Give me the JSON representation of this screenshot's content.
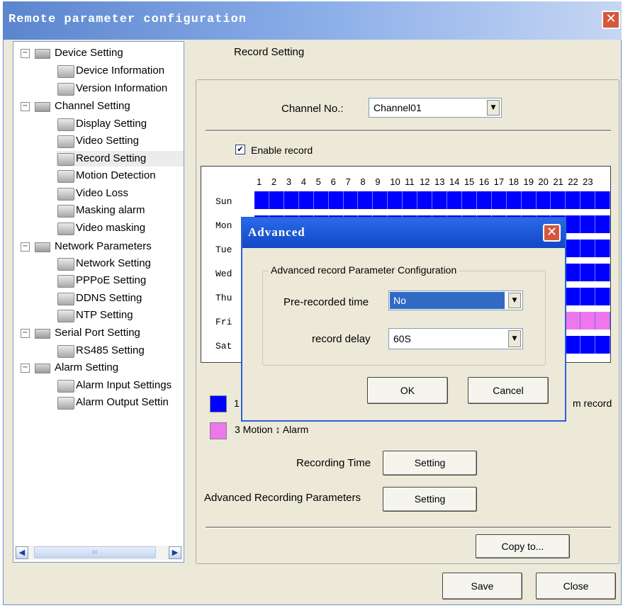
{
  "window": {
    "title": "Remote parameter configuration"
  },
  "tree": {
    "groups": [
      {
        "label": "Device Setting",
        "items": [
          "Device Information",
          "Version Information"
        ]
      },
      {
        "label": "Channel Setting",
        "items": [
          "Display Setting",
          "Video Setting",
          "Record Setting",
          "Motion Detection",
          "Video Loss",
          "Masking alarm",
          "Video masking"
        ]
      },
      {
        "label": "Network Parameters",
        "items": [
          "Network Setting",
          "PPPoE Setting",
          "DDNS Setting",
          "NTP Setting"
        ]
      },
      {
        "label": "Serial Port Setting",
        "items": [
          "RS485 Setting"
        ]
      },
      {
        "label": "Alarm Setting",
        "items": [
          "Alarm Input Settings",
          "Alarm Output Settin"
        ]
      }
    ],
    "selected": "Record Setting",
    "scroll_thumb_text": "III"
  },
  "record": {
    "heading": "Record Setting",
    "channel_label": "Channel No.:",
    "channel_value": "Channel01",
    "enable_label": "Enable record",
    "enable_checked": true,
    "hours": [
      "1",
      "2",
      "3",
      "4",
      "5",
      "6",
      "7",
      "8",
      "9",
      "10",
      "11",
      "12",
      "13",
      "14",
      "15",
      "16",
      "17",
      "18",
      "19",
      "20",
      "21",
      "22",
      "23"
    ],
    "days": [
      "Sun",
      "Mon",
      "Tue",
      "Wed",
      "Thu",
      "Fri",
      "Sat"
    ],
    "legend_1_label": "1",
    "legend_right_text": "m record",
    "legend_3_label": "3 Motion ↕ Alarm",
    "recording_time_label": "Recording Time",
    "advanced_params_label": "Advanced Recording Parameters",
    "setting_label": "Setting",
    "copy_label": "Copy to...",
    "save_label": "Save",
    "close_label": "Close",
    "colors": {
      "scheduled": "#0000ff",
      "motion_alarm": "#ee77ee"
    }
  },
  "dialog": {
    "title": "Advanced",
    "group_label": "Advanced record Parameter Configuration",
    "prerecord_label": "Pre-recorded time",
    "prerecord_value": "No",
    "delay_label": "record delay",
    "delay_value": "60S",
    "ok_label": "OK",
    "cancel_label": "Cancel"
  },
  "icons": {
    "close": "close-icon",
    "dropdown": "chevron-down-icon",
    "checkbox": "checkmark-icon"
  }
}
